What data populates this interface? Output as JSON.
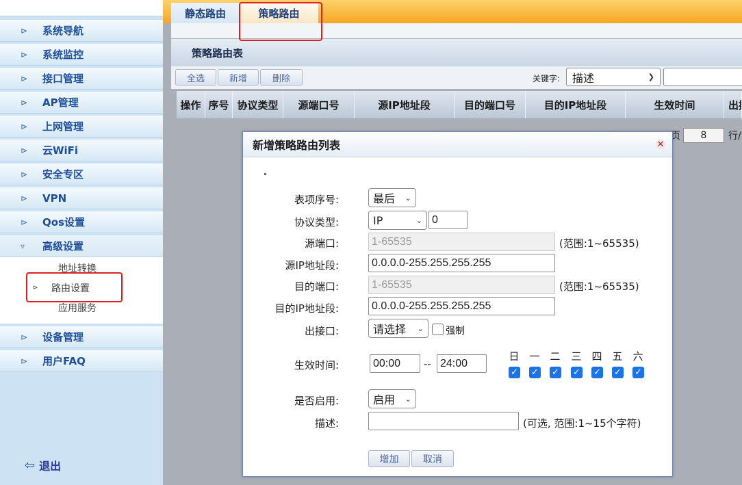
{
  "sidebar": {
    "items": [
      {
        "label": "系统导航"
      },
      {
        "label": "系统监控"
      },
      {
        "label": "接口管理"
      },
      {
        "label": "AP管理"
      },
      {
        "label": "上网管理"
      },
      {
        "label": "云WiFi"
      },
      {
        "label": "安全专区"
      },
      {
        "label": "VPN"
      },
      {
        "label": "Qos设置"
      },
      {
        "label": "高级设置"
      },
      {
        "label": "设备管理"
      },
      {
        "label": "用户FAQ"
      }
    ],
    "submenu": [
      {
        "label": "地址转换"
      },
      {
        "label": "路由设置"
      },
      {
        "label": "应用服务"
      }
    ],
    "logout_label": "退出"
  },
  "tabs": [
    {
      "label": "静态路由"
    },
    {
      "label": "策略路由"
    }
  ],
  "panel": {
    "title": "策略路由表",
    "toolbar": {
      "select_all": "全选",
      "add": "新增",
      "delete": "删除",
      "keyword_label": "关键字:",
      "keyword_value": "描述"
    },
    "columns": [
      "操作",
      "序号",
      "协议类型",
      "源端口号",
      "源IP地址段",
      "目的端口号",
      "目的IP地址段",
      "生效时间",
      "出接"
    ],
    "pager": {
      "prefix": "页",
      "page_size": "8",
      "suffix": "行/"
    }
  },
  "dialog": {
    "title": "新增策略路由列表",
    "fields": {
      "index": {
        "label": "表项序号:",
        "value": "最后"
      },
      "protocol": {
        "label": "协议类型:",
        "value": "IP",
        "number": "0"
      },
      "src_port": {
        "label": "源端口:",
        "placeholder": "1-65535",
        "hint": "(范围:1~65535)"
      },
      "src_ip": {
        "label": "源IP地址段:",
        "value": "0.0.0.0-255.255.255.255"
      },
      "dst_port": {
        "label": "目的端口:",
        "placeholder": "1-65535",
        "hint": "(范围:1~65535)"
      },
      "dst_ip": {
        "label": "目的IP地址段:",
        "value": "0.0.0.0-255.255.255.255"
      },
      "out_iface": {
        "label": "出接口:",
        "value": "请选择",
        "force_label": "强制"
      },
      "time": {
        "label": "生效时间:",
        "start": "00:00",
        "separator": "--",
        "end": "24:00"
      },
      "enabled": {
        "label": "是否启用:",
        "value": "启用"
      },
      "desc": {
        "label": "描述:",
        "value": "",
        "hint": "(可选, 范围:1~15个字符)"
      }
    },
    "days": [
      {
        "label": "日",
        "checked": true
      },
      {
        "label": "一",
        "checked": true
      },
      {
        "label": "二",
        "checked": true
      },
      {
        "label": "三",
        "checked": true
      },
      {
        "label": "四",
        "checked": true
      },
      {
        "label": "五",
        "checked": true
      },
      {
        "label": "六",
        "checked": true
      }
    ],
    "buttons": {
      "add": "增加",
      "cancel": "取消"
    }
  },
  "colors": {
    "accent_orange": "#f6a623",
    "menu_text": "#1d4f99",
    "highlight_red": "#e02020",
    "checkbox_blue": "#1a73e8"
  }
}
